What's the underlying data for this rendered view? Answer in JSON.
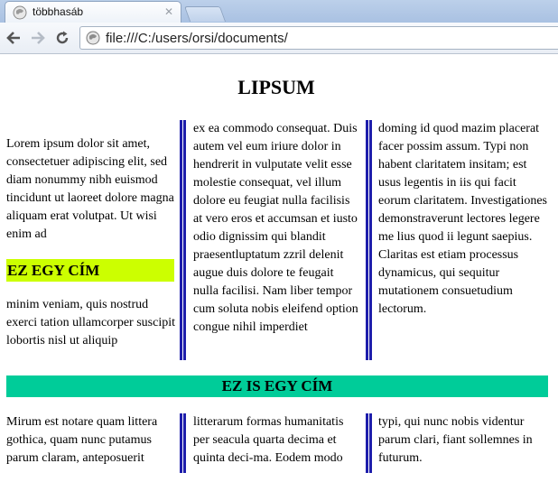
{
  "browser": {
    "tab": {
      "title": "többhasáb"
    },
    "address": {
      "url": "file:///C:/users/orsi/documents/"
    }
  },
  "page": {
    "title": "LIPSUM",
    "section1": {
      "col1_top": "Lorem ipsum dolor sit amet, consectetuer adipiscing elit, sed diam nonummy nibh euismod tincidunt ut laoreet dolore magna aliquam erat volutpat. Ut wisi enim ad",
      "heading": "EZ EGY CÍM",
      "col1_bottom": "minim veniam, quis nostrud exerci tation ullamcorper suscipit lobortis nisl ut aliquip",
      "col2": "ex ea commodo consequat. Duis autem vel eum iriure dolor in hendrerit in vulputate velit esse molestie consequat, vel illum dolore eu feugiat nulla facilisis at vero eros et accumsan et iusto odio dignissim qui blandit praesentluptatum zzril delenit augue duis dolore te feugait nulla facilisi. Nam liber tempor cum soluta nobis eleifend option congue nihil imperdiet",
      "col3": "doming id quod mazim placerat facer possim assum. Typi non habent claritatem insitam; est usus legentis in iis qui facit eorum claritatem. Investigationes demonstraverunt lectores legere me lius quod ii legunt saepius. Claritas est etiam processus dynamicus, qui sequitur mutationem consuetudium lectorum."
    },
    "section2": {
      "heading": "EZ IS EGY CÍM",
      "col1": "Mirum est notare quam littera gothica, quam nunc putamus parum claram, anteposuerit",
      "col2": "litterarum formas humanitatis per seacula quarta decima et quinta deci-ma. Eodem modo",
      "col3": "typi, qui nunc nobis videntur parum clari, fiant sollemnes in futurum."
    },
    "colors": {
      "heading1_bg": "#ccff00",
      "heading2_bg": "#00cc99",
      "column_rule": "#1e1eab"
    }
  }
}
